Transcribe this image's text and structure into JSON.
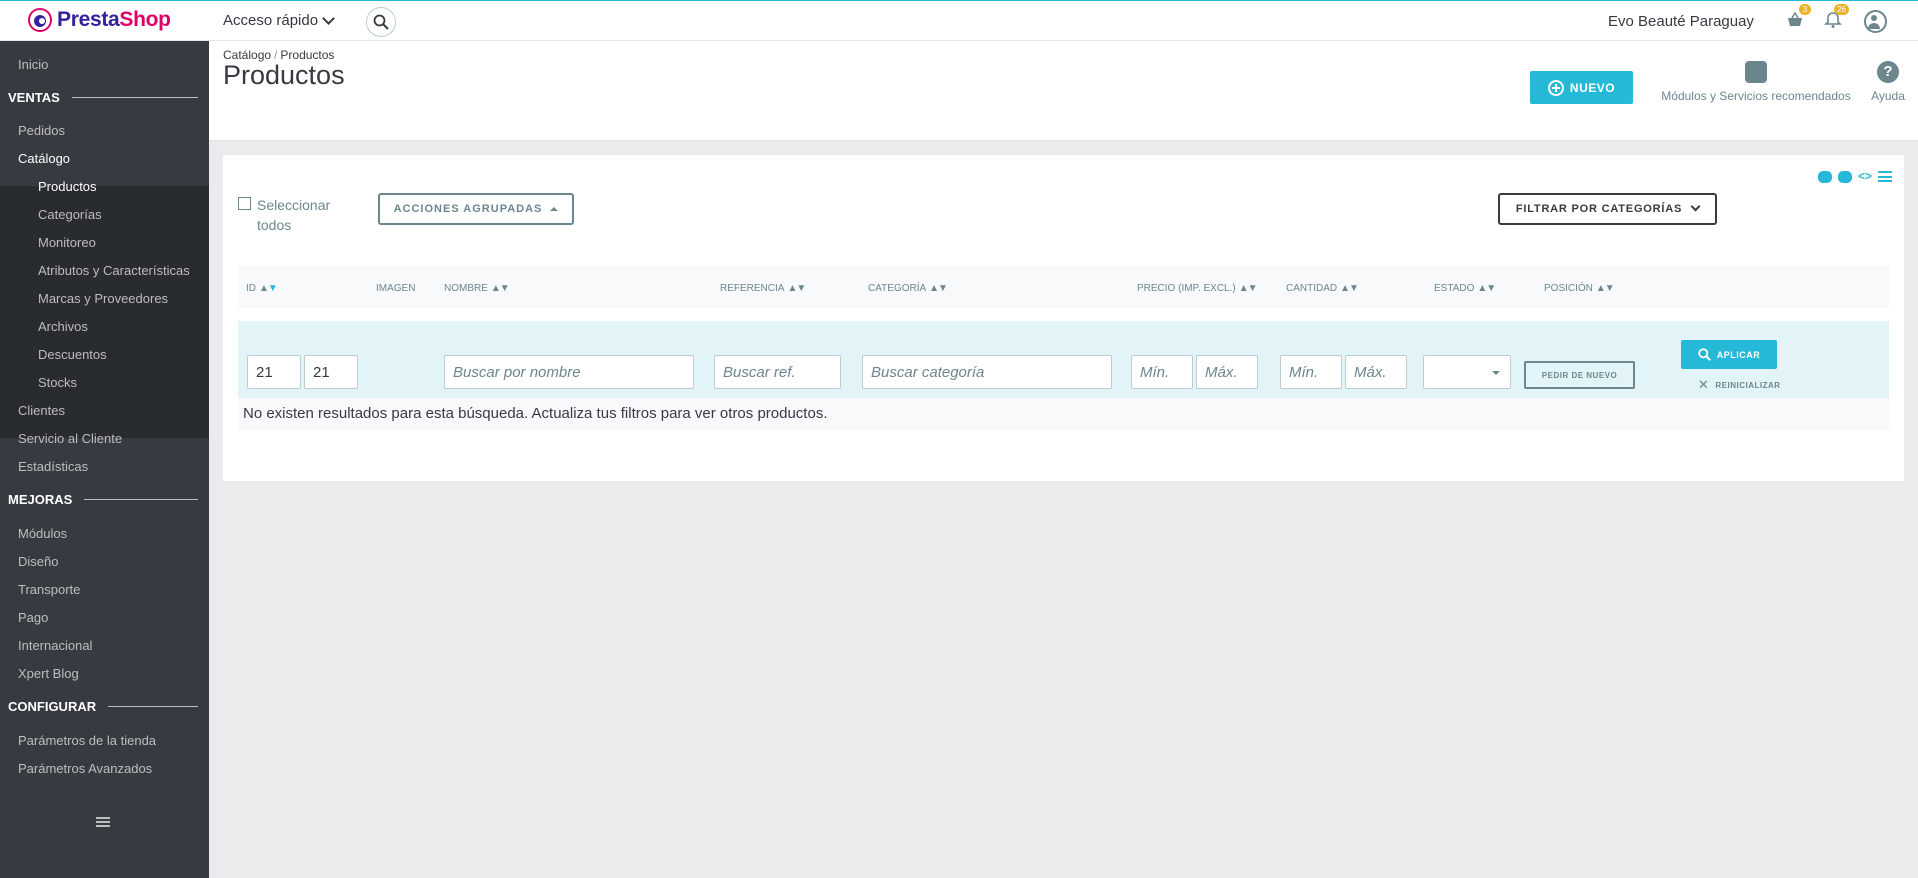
{
  "header": {
    "logo_prefix": "Presta",
    "logo_suffix": "Shop",
    "quick_access": "Acceso rápido",
    "shop_name": "Evo Beauté Paraguay",
    "orders_badge": "3",
    "notifications_badge": "26"
  },
  "sidebar": {
    "home": "Inicio",
    "sales_title": "VENTAS",
    "orders": "Pedidos",
    "catalog": "Catálogo",
    "catalog_items": [
      "Productos",
      "Categorías",
      "Monitoreo",
      "Atributos y Características",
      "Marcas y Proveedores",
      "Archivos",
      "Descuentos",
      "Stocks"
    ],
    "customers": "Clientes",
    "customer_service": "Servicio al Cliente",
    "stats": "Estadísticas",
    "improve_title": "MEJORAS",
    "improve_items": [
      "Módulos",
      "Diseño",
      "Transporte",
      "Pago",
      "Internacional",
      "Xpert Blog"
    ],
    "configure_title": "CONFIGURAR",
    "configure_items": [
      "Parámetros de la tienda",
      "Parámetros Avanzados"
    ]
  },
  "page": {
    "breadcrumb": [
      "Catálogo",
      "Productos"
    ],
    "title": "Productos",
    "new_button": "NUEVO",
    "modules_label": "Módulos y Servicios recomendados",
    "help_label": "Ayuda"
  },
  "toolbar": {
    "select_all": "Seleccionar todos",
    "bulk_actions": "ACCIONES AGRUPADAS",
    "filter_categories": "FILTRAR POR CATEGORÍAS"
  },
  "table": {
    "columns": {
      "id": "ID",
      "image": "IMAGEN",
      "name": "NOMBRE",
      "reference": "REFERENCIA",
      "category": "CATEGORÍA",
      "price": "PRECIO (IMP. EXCL.)",
      "quantity": "CANTIDAD",
      "state": "ESTADO",
      "position": "POSICIÓN"
    },
    "filters": {
      "id_from": "21",
      "id_to": "21",
      "name_placeholder": "Buscar por nombre",
      "ref_placeholder": "Buscar ref.",
      "category_placeholder": "Buscar categoría",
      "min_placeholder": "Mín.",
      "max_placeholder": "Máx."
    },
    "reorder_button": "PEDIR DE NUEVO",
    "apply_button": "APLICAR",
    "reset_button": "REINICIALIZAR",
    "no_results": "No existen resultados para esta búsqueda. Actualiza tus filtros para ver otros productos."
  }
}
